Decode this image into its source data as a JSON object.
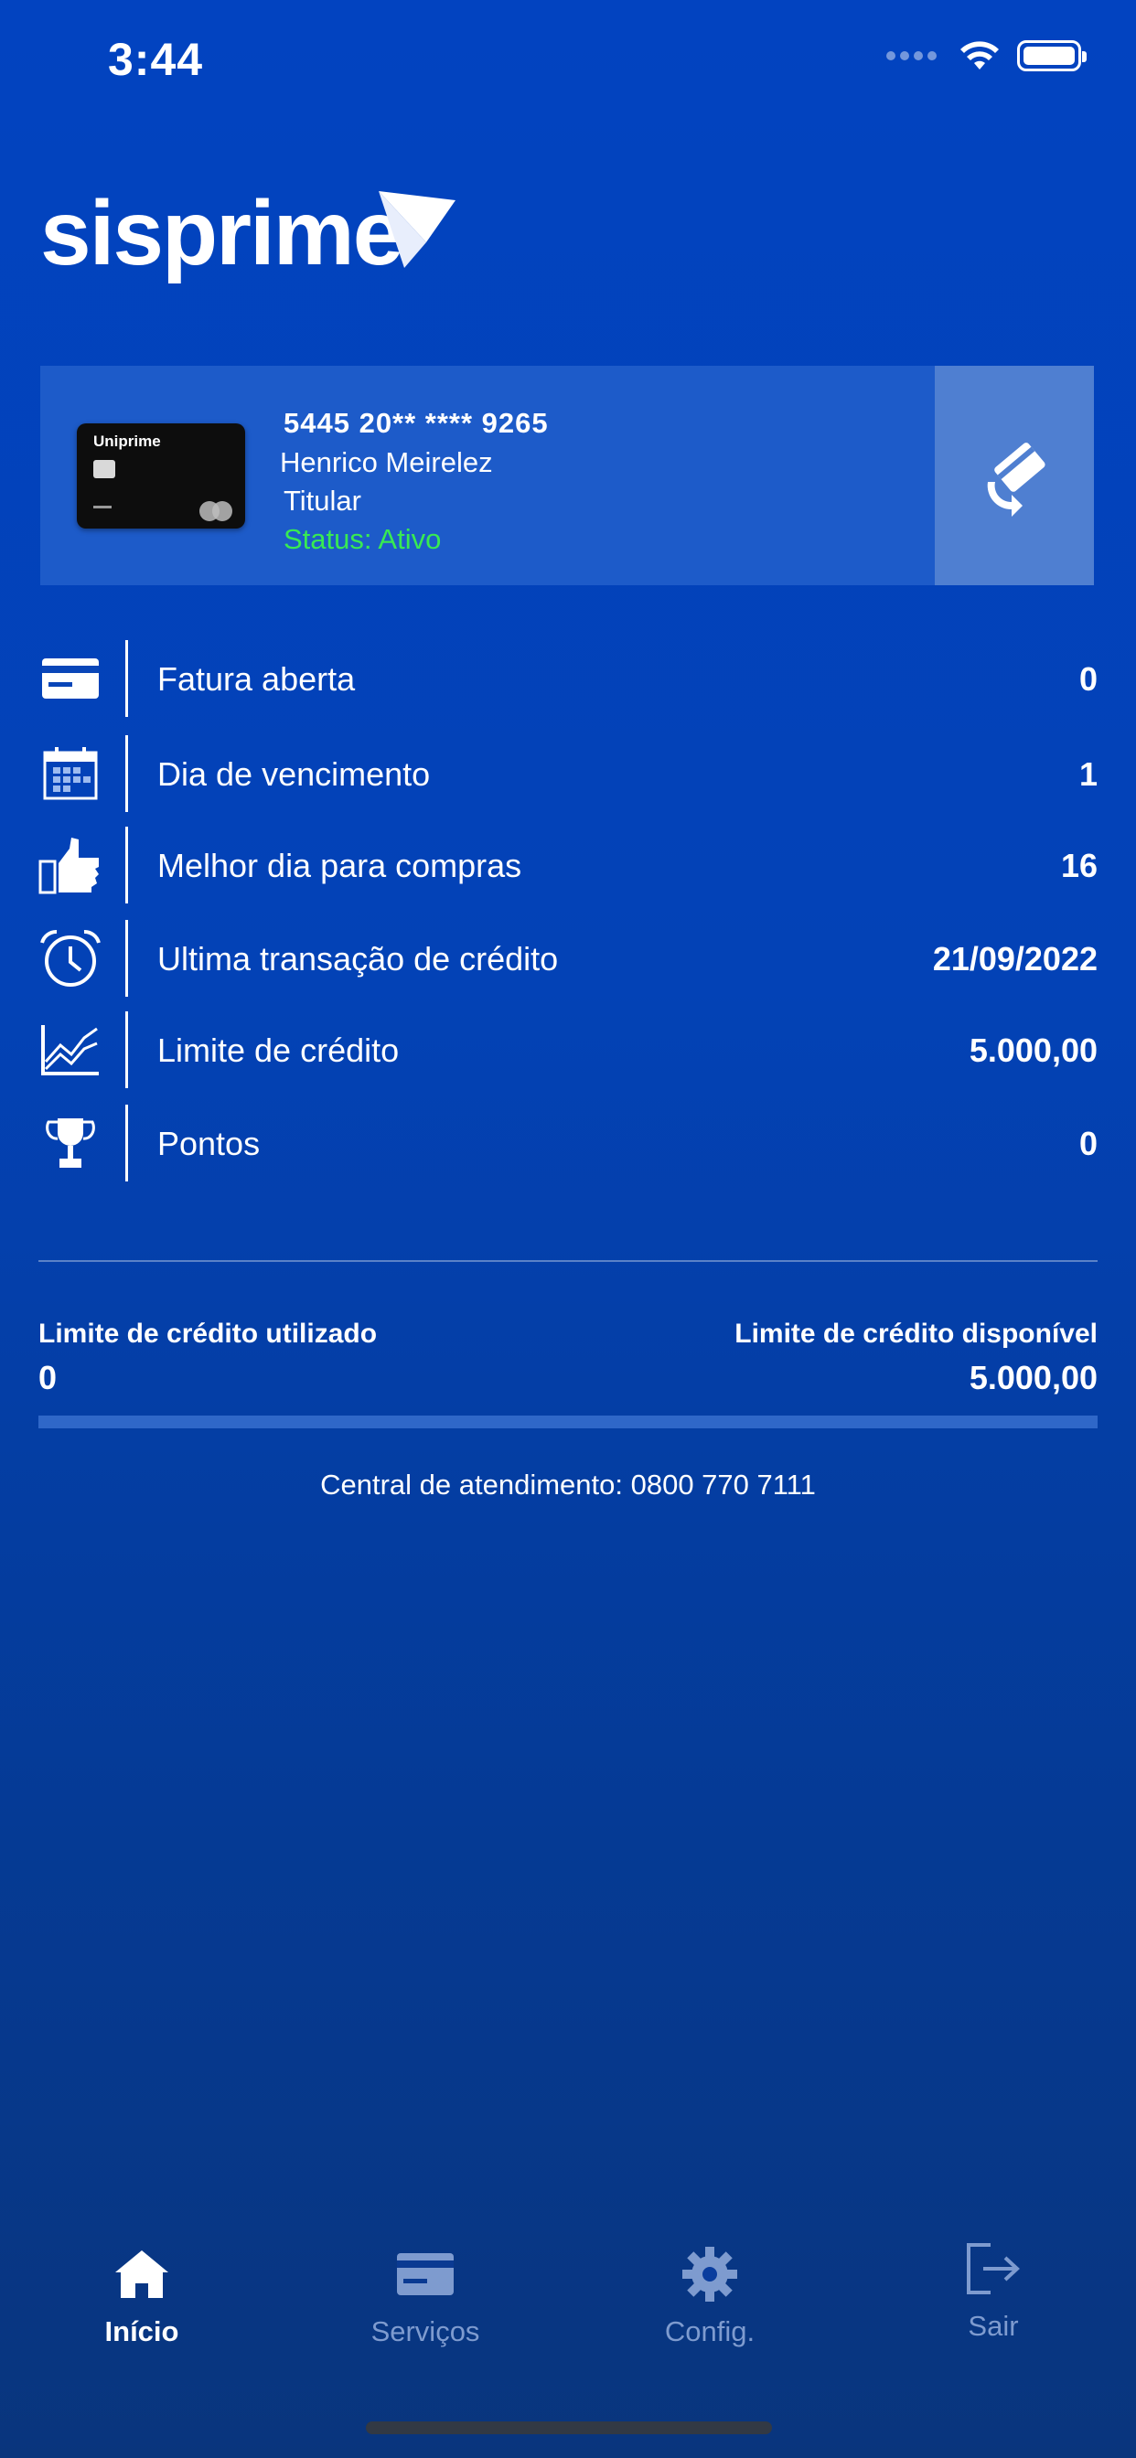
{
  "status_bar": {
    "time": "3:44"
  },
  "brand": {
    "logo_text": "sisprime"
  },
  "card": {
    "brand_label": "Uniprime",
    "number": "5445 20** **** 9265",
    "holder": "Henrico Meirelez",
    "role": "Titular",
    "status": "Status: Ativo"
  },
  "info_rows": [
    {
      "icon": "invoice-card-icon",
      "label": "Fatura aberta",
      "value": "0"
    },
    {
      "icon": "calendar-icon",
      "label": "Dia de vencimento",
      "value": "1"
    },
    {
      "icon": "thumbs-up-icon",
      "label": "Melhor dia para compras",
      "value": "16"
    },
    {
      "icon": "alarm-clock-icon",
      "label": "Ultima transação de crédito",
      "value": "21/09/2022"
    },
    {
      "icon": "line-chart-icon",
      "label": "Limite de crédito",
      "value": "5.000,00"
    },
    {
      "icon": "trophy-icon",
      "label": "Pontos",
      "value": "0"
    }
  ],
  "limits": {
    "used_label": "Limite de crédito utilizado",
    "used_value": "0",
    "available_label": "Limite de crédito disponível",
    "available_value": "5.000,00",
    "used_fraction": 0
  },
  "support": {
    "text": "Central de atendimento: 0800 770 7111"
  },
  "tab_bar": {
    "tabs": [
      {
        "label": "Início",
        "icon": "home-icon",
        "active": true
      },
      {
        "label": "Serviços",
        "icon": "card-icon",
        "active": false
      },
      {
        "label": "Config.",
        "icon": "gear-icon",
        "active": false
      },
      {
        "label": "Sair",
        "icon": "logout-icon",
        "active": false
      }
    ]
  },
  "colors": {
    "background": "#0243c0",
    "card_panel": "#1d5bc9",
    "swap_button": "#4f7fd1",
    "status_active": "#38ea52",
    "tab_inactive": "#7e9bcf"
  }
}
